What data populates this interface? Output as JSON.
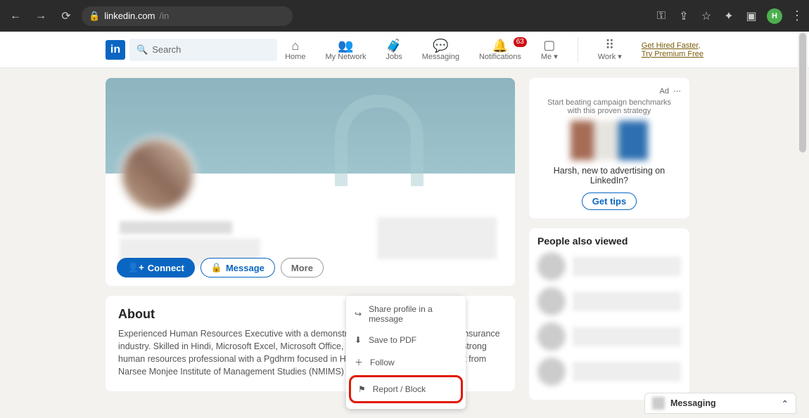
{
  "browser": {
    "url_domain": "linkedin.com",
    "url_path": "/in",
    "avatar_initial": "H"
  },
  "topnav": {
    "logo": "in",
    "search_placeholder": "Search",
    "items": [
      {
        "label": "Home"
      },
      {
        "label": "My Network"
      },
      {
        "label": "Jobs"
      },
      {
        "label": "Messaging"
      },
      {
        "label": "Notifications",
        "badge": "63"
      },
      {
        "label": "Me ▾"
      },
      {
        "label": "Work ▾"
      }
    ],
    "premium": {
      "line1": "Get Hired Faster,",
      "line2": "Try Premium Free"
    }
  },
  "profile_actions": {
    "connect": "Connect",
    "message": "Message",
    "more": "More"
  },
  "more_menu": {
    "share": "Share profile in a message",
    "pdf": "Save to PDF",
    "follow": "Follow",
    "report": "Report / Block"
  },
  "about": {
    "title": "About",
    "body": "Experienced Human Resources Executive with a demonstrated history of working in the insurance industry. Skilled in Hindi, Microsoft Excel, Microsoft Office, Microsoft Word, and English. Strong human resources professional with a Pgdhrm focused in Human Resources Management from Narsee Monjee Institute of Management Studies (NMIMS) Navi Mumbai."
  },
  "ad": {
    "label": "Ad",
    "subtitle": "Start beating campaign benchmarks with this proven strategy",
    "line": "Harsh, new to advertising on LinkedIn?",
    "cta": "Get tips"
  },
  "sidebar": {
    "people_also_viewed": "People also viewed"
  },
  "messaging": {
    "label": "Messaging"
  }
}
